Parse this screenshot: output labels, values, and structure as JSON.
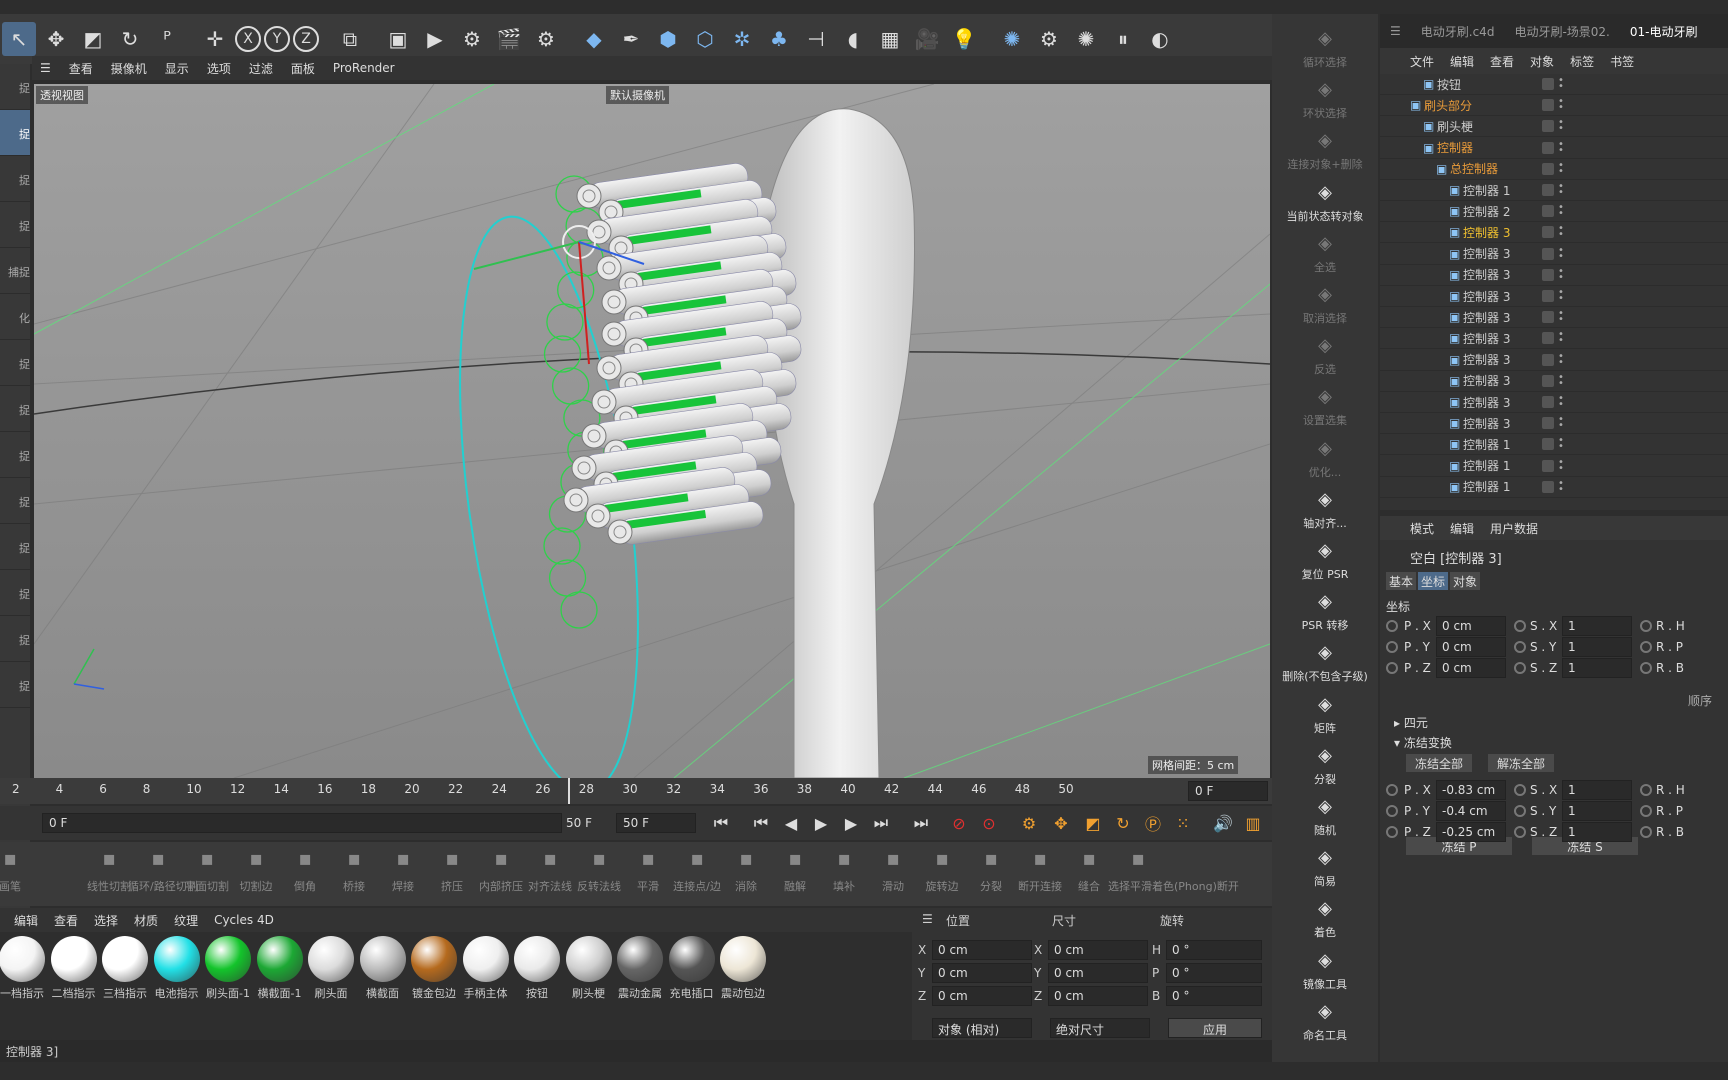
{
  "toolbar": {
    "icons": [
      "select-arrow-icon",
      "move-icon",
      "scale-icon",
      "rotate-icon",
      "psr-icon",
      "live-select-icon",
      "axis-x-icon",
      "axis-y-icon",
      "axis-z-icon",
      "coordinate-system-icon",
      "render-view-icon",
      "render-settings-icon",
      "render-icon",
      "render-picture-icon",
      "render-options-icon",
      "cube-icon",
      "pen-icon",
      "subdivision-icon",
      "extrude-icon",
      "cloner-icon",
      "mograph-icon",
      "deformer-icon",
      "spline-icon",
      "floor-icon",
      "camera-icon",
      "light-icon",
      "effector-icon",
      "settings-icon",
      "simulation-icon",
      "pause-icon",
      "contrast-icon"
    ],
    "axis_labels": [
      "X",
      "Y",
      "Z"
    ]
  },
  "left_strip": [
    "捉",
    "捉",
    "捉",
    "捉",
    "捕捉",
    "化",
    "捉",
    "捉",
    "捉",
    "捉",
    "捉",
    "捉",
    "捉",
    "捉"
  ],
  "viewport": {
    "menu": [
      "查看",
      "摄像机",
      "显示",
      "选项",
      "过滤",
      "面板",
      "ProRender"
    ],
    "label": "透视视图",
    "camera": "默认摄像机",
    "grid": "网格间距：5 cm"
  },
  "timeline": {
    "ticks": [
      "2",
      "4",
      "6",
      "8",
      "10",
      "12",
      "14",
      "16",
      "18",
      "20",
      "22",
      "24",
      "26",
      "28",
      "30",
      "32",
      "34",
      "36",
      "38",
      "40",
      "42",
      "44",
      "46",
      "48",
      "50"
    ],
    "current_frame": "0 F"
  },
  "playback": {
    "start": "0 F",
    "end_label": "50 F",
    "end_field": "50 F"
  },
  "mesh_tools": [
    "画笔",
    "线性切割",
    "循环/路径切割",
    "平面切割",
    "切割边",
    "倒角",
    "桥接",
    "焊接",
    "挤压",
    "内部挤压",
    "对齐法线",
    "反转法线",
    "平滑",
    "连接点/边",
    "消除",
    "融解",
    "填补",
    "滑动",
    "旋转边",
    "分裂",
    "断开连接",
    "缝合",
    "选择平滑着色(Phong)断开"
  ],
  "material_menu": [
    "编辑",
    "查看",
    "选择",
    "材质",
    "纹理",
    "Cycles 4D"
  ],
  "materials": [
    {
      "name": "一档指示",
      "color": "#f4f4f4"
    },
    {
      "name": "二档指示",
      "color": "#ffffff"
    },
    {
      "name": "三档指示",
      "color": "#ffffff"
    },
    {
      "name": "电池指示",
      "color": "#22e0e6"
    },
    {
      "name": "刷头面-1",
      "color": "#13c42b"
    },
    {
      "name": "横截面-1",
      "color": "#1ca834"
    },
    {
      "name": "刷头面",
      "color": "#dcdcdc"
    },
    {
      "name": "横截面",
      "color": "#bcbcbc"
    },
    {
      "name": "镀金包边",
      "color": "#b56a1e"
    },
    {
      "name": "手柄主体",
      "color": "#efefef"
    },
    {
      "name": "按钮",
      "color": "#eaeaea"
    },
    {
      "name": "刷头梗",
      "color": "#cfcfcf"
    },
    {
      "name": "震动金属",
      "color": "#666666"
    },
    {
      "name": "充电插口",
      "color": "#555555"
    },
    {
      "name": "震动包边",
      "color": "#ede6d6"
    }
  ],
  "coord": {
    "headers": [
      "位置",
      "尺寸",
      "旋转"
    ],
    "rows": [
      {
        "axis": "X",
        "pos": "0 cm",
        "size_axis": "X",
        "size": "0 cm",
        "rot_axis": "H",
        "rot": "0 °"
      },
      {
        "axis": "Y",
        "pos": "0 cm",
        "size_axis": "Y",
        "size": "0 cm",
        "rot_axis": "P",
        "rot": "0 °"
      },
      {
        "axis": "Z",
        "pos": "0 cm",
        "size_axis": "Z",
        "size": "0 cm",
        "rot_axis": "B",
        "rot": "0 °"
      }
    ],
    "mode": "对象 (相对)",
    "size_mode": "绝对尺寸",
    "apply": "应用"
  },
  "status": "控制器 3]",
  "right_tools": [
    {
      "label": "循环选择",
      "dim": true,
      "icon": "loop-select-icon"
    },
    {
      "label": "环状选择",
      "dim": true,
      "icon": "ring-select-icon"
    },
    {
      "label": "连接对象+删除",
      "dim": true,
      "icon": "connect-delete-icon"
    },
    {
      "label": "当前状态转对象",
      "dim": false,
      "icon": "current-state-icon"
    },
    {
      "label": "全选",
      "dim": true,
      "icon": "select-all-icon"
    },
    {
      "label": "取消选择",
      "dim": true,
      "icon": "deselect-icon"
    },
    {
      "label": "反选",
      "dim": true,
      "icon": "invert-select-icon"
    },
    {
      "label": "设置选集",
      "dim": true,
      "icon": "set-selection-icon"
    },
    {
      "label": "优化...",
      "dim": true,
      "icon": "optimize-icon"
    },
    {
      "label": "轴对齐...",
      "dim": false,
      "icon": "axis-align-icon"
    },
    {
      "label": "复位 PSR",
      "dim": false,
      "icon": "reset-psr-icon"
    },
    {
      "label": "PSR 转移",
      "dim": false,
      "icon": "transfer-psr-icon"
    },
    {
      "label": "删除(不包含子级)",
      "dim": false,
      "icon": "delete-no-children-icon"
    },
    {
      "label": "矩阵",
      "dim": false,
      "icon": "matrix-icon"
    },
    {
      "label": "分裂",
      "dim": false,
      "icon": "fracture-icon"
    },
    {
      "label": "随机",
      "dim": false,
      "icon": "random-icon"
    },
    {
      "label": "简易",
      "dim": false,
      "icon": "plain-icon"
    },
    {
      "label": "着色",
      "dim": false,
      "icon": "shader-icon"
    },
    {
      "label": "镜像工具",
      "dim": false,
      "icon": "mirror-tool-icon"
    },
    {
      "label": "命名工具",
      "dim": false,
      "icon": "naming-tool-icon"
    }
  ],
  "objmgr": {
    "tabs": [
      "电动牙刷.c4d",
      "电动牙刷-场景02.",
      "01-电动牙刷"
    ],
    "menu": [
      "文件",
      "编辑",
      "查看",
      "对象",
      "标签",
      "书签"
    ],
    "rows": [
      {
        "name": "按钮",
        "indent": 1,
        "color": "#cccccc"
      },
      {
        "name": "刷头部分",
        "indent": 0,
        "color": "#e89b3a"
      },
      {
        "name": "刷头梗",
        "indent": 1,
        "color": "#cccccc"
      },
      {
        "name": "控制器",
        "indent": 1,
        "color": "#e89b3a"
      },
      {
        "name": "总控制器",
        "indent": 2,
        "color": "#e89b3a"
      },
      {
        "name": "控制器 1",
        "indent": 3,
        "color": "#cccccc"
      },
      {
        "name": "控制器 2",
        "indent": 3,
        "color": "#cccccc"
      },
      {
        "name": "控制器 3",
        "indent": 3,
        "color": "#f0c030"
      },
      {
        "name": "控制器 3",
        "indent": 3,
        "color": "#cccccc"
      },
      {
        "name": "控制器 3",
        "indent": 3,
        "color": "#cccccc"
      },
      {
        "name": "控制器 3",
        "indent": 3,
        "color": "#cccccc"
      },
      {
        "name": "控制器 3",
        "indent": 3,
        "color": "#cccccc"
      },
      {
        "name": "控制器 3",
        "indent": 3,
        "color": "#cccccc"
      },
      {
        "name": "控制器 3",
        "indent": 3,
        "color": "#cccccc"
      },
      {
        "name": "控制器 3",
        "indent": 3,
        "color": "#cccccc"
      },
      {
        "name": "控制器 3",
        "indent": 3,
        "color": "#cccccc"
      },
      {
        "name": "控制器 3",
        "indent": 3,
        "color": "#cccccc"
      },
      {
        "name": "控制器 1",
        "indent": 3,
        "color": "#cccccc"
      },
      {
        "name": "控制器 1",
        "indent": 3,
        "color": "#cccccc"
      },
      {
        "name": "控制器 1",
        "indent": 3,
        "color": "#cccccc"
      }
    ]
  },
  "attr": {
    "menu": [
      "模式",
      "编辑",
      "用户数据"
    ],
    "title": "空白 [控制器 3]",
    "tabs": [
      "基本",
      "坐标",
      "对象"
    ],
    "section": "坐标",
    "coords": [
      {
        "l": "P . X",
        "v": "0 cm",
        "sl": "S . X",
        "sv": "1",
        "rl": "R . H"
      },
      {
        "l": "P . Y",
        "v": "0 cm",
        "sl": "S . Y",
        "sv": "1",
        "rl": "R . P"
      },
      {
        "l": "P . Z",
        "v": "0 cm",
        "sl": "S . Z",
        "sv": "1",
        "rl": "R . B"
      }
    ],
    "order": "顺序",
    "quat": "四元",
    "freeze": "冻结变换",
    "freeze_all": "冻结全部",
    "unfreeze_all": "解冻全部",
    "frozen": [
      {
        "l": "P . X",
        "v": "-0.83 cm",
        "sl": "S . X",
        "sv": "1",
        "rl": "R . H"
      },
      {
        "l": "P . Y",
        "v": "-0.4 cm",
        "sl": "S . Y",
        "sv": "1",
        "rl": "R . P"
      },
      {
        "l": "P . Z",
        "v": "-0.25 cm",
        "sl": "S . Z",
        "sv": "1",
        "rl": "R . B"
      }
    ],
    "freeze_p": "冻结 P",
    "freeze_s": "冻结 S"
  }
}
